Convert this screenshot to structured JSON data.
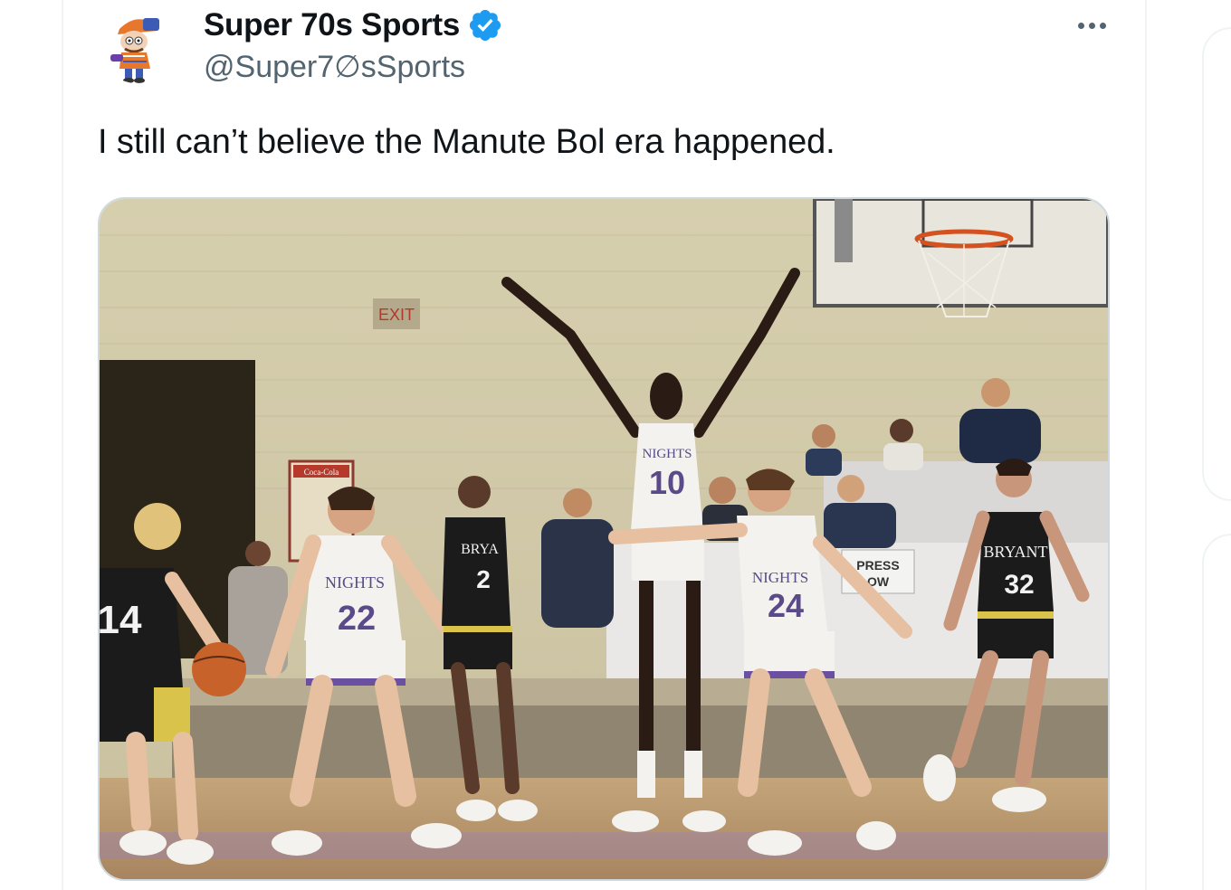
{
  "tweet": {
    "author": {
      "display_name": "Super 70s Sports",
      "handle": "@Super7∅sSports",
      "verified": true,
      "avatar_icon": "cartoon-mascot-avatar"
    },
    "text": "I still can’t believe the Manute Bol era happened.",
    "menu_icon": "more-dots-icon",
    "media": {
      "kind": "photo",
      "scene_text": {
        "exit_sign": "EXIT",
        "coca_cola": "Coca-Cola",
        "press_sign_line1": "PRESS",
        "press_sign_line2": "OW",
        "player_center_team": "NIGHTS",
        "player_center_number": "10",
        "player_left_team": "NIGHTS",
        "player_left_number": "22",
        "player_right_team": "NIGHTS",
        "player_right_number": "24",
        "opponent_far_team": "BRYANT",
        "opponent_far_number": "32",
        "opponent_mid_team": "BRYA",
        "opponent_mid_number": "2",
        "opponent_left_number": "14"
      }
    }
  },
  "colors": {
    "text_primary": "#0f1419",
    "text_secondary": "#536471",
    "verified_blue": "#1d9bf0",
    "border": "#cfd9de"
  }
}
